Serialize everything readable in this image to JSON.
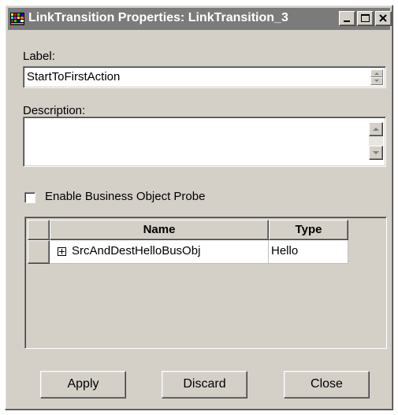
{
  "window": {
    "title": "LinkTransition Properties: LinkTransition_3",
    "icon": "app-grid-icon",
    "controls": [
      "minimize-icon",
      "maximize-icon",
      "close-icon"
    ]
  },
  "label_field": {
    "caption": "Label:",
    "value": "StartToFirstAction"
  },
  "description_field": {
    "caption": "Description:",
    "value": ""
  },
  "probe": {
    "label": "Enable Business Object Probe",
    "checked": false
  },
  "table": {
    "columns": [
      "Name",
      "Type"
    ],
    "rows": [
      {
        "expander": "expand-plus-icon",
        "name": "SrcAndDestHelloBusObj",
        "type": "Hello"
      }
    ]
  },
  "buttons": {
    "apply": "Apply",
    "discard": "Discard",
    "close": "Close"
  },
  "colors": {
    "face": "#d4d0c8",
    "titlebar": "#7b7b7b"
  }
}
